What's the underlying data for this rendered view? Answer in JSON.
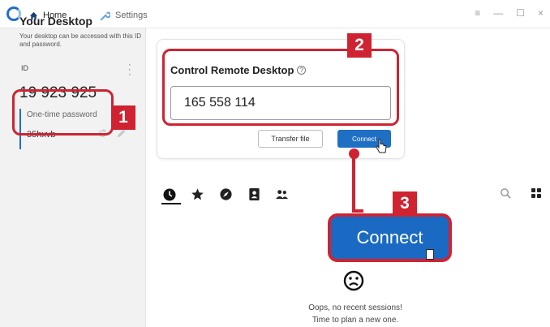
{
  "titlebar": {
    "tabs": [
      {
        "label": "Home",
        "icon": "home-icon"
      },
      {
        "label": "Settings",
        "icon": "wrench-icon"
      }
    ],
    "window_controls": [
      "≡",
      "—",
      "☐",
      "×"
    ]
  },
  "sidebar": {
    "title": "Your Desktop",
    "description": "Your desktop can be accessed with this ID and password.",
    "id_label": "ID",
    "id_value": "19 923 925",
    "otp_label": "One-time password",
    "otp_value": "35hxvb"
  },
  "remote": {
    "title": "Control Remote Desktop",
    "help": "?",
    "input_value": "165 558 114",
    "transfer_button": "Transfer file",
    "connect_button": "Connect"
  },
  "nav_icons": [
    "recent-icon",
    "favorites-icon",
    "discover-icon",
    "address-book-icon",
    "people-icon"
  ],
  "empty_state": {
    "line1": "Oops, no recent sessions!",
    "line2": "Time to plan a new one."
  },
  "annotations": {
    "badge_1": "1",
    "badge_2": "2",
    "badge_3": "3",
    "big_connect_label": "Connect",
    "color": "#cf2331"
  },
  "colors": {
    "accent": "#1f6fc5",
    "sidebar_bg": "#f2f2f2"
  }
}
